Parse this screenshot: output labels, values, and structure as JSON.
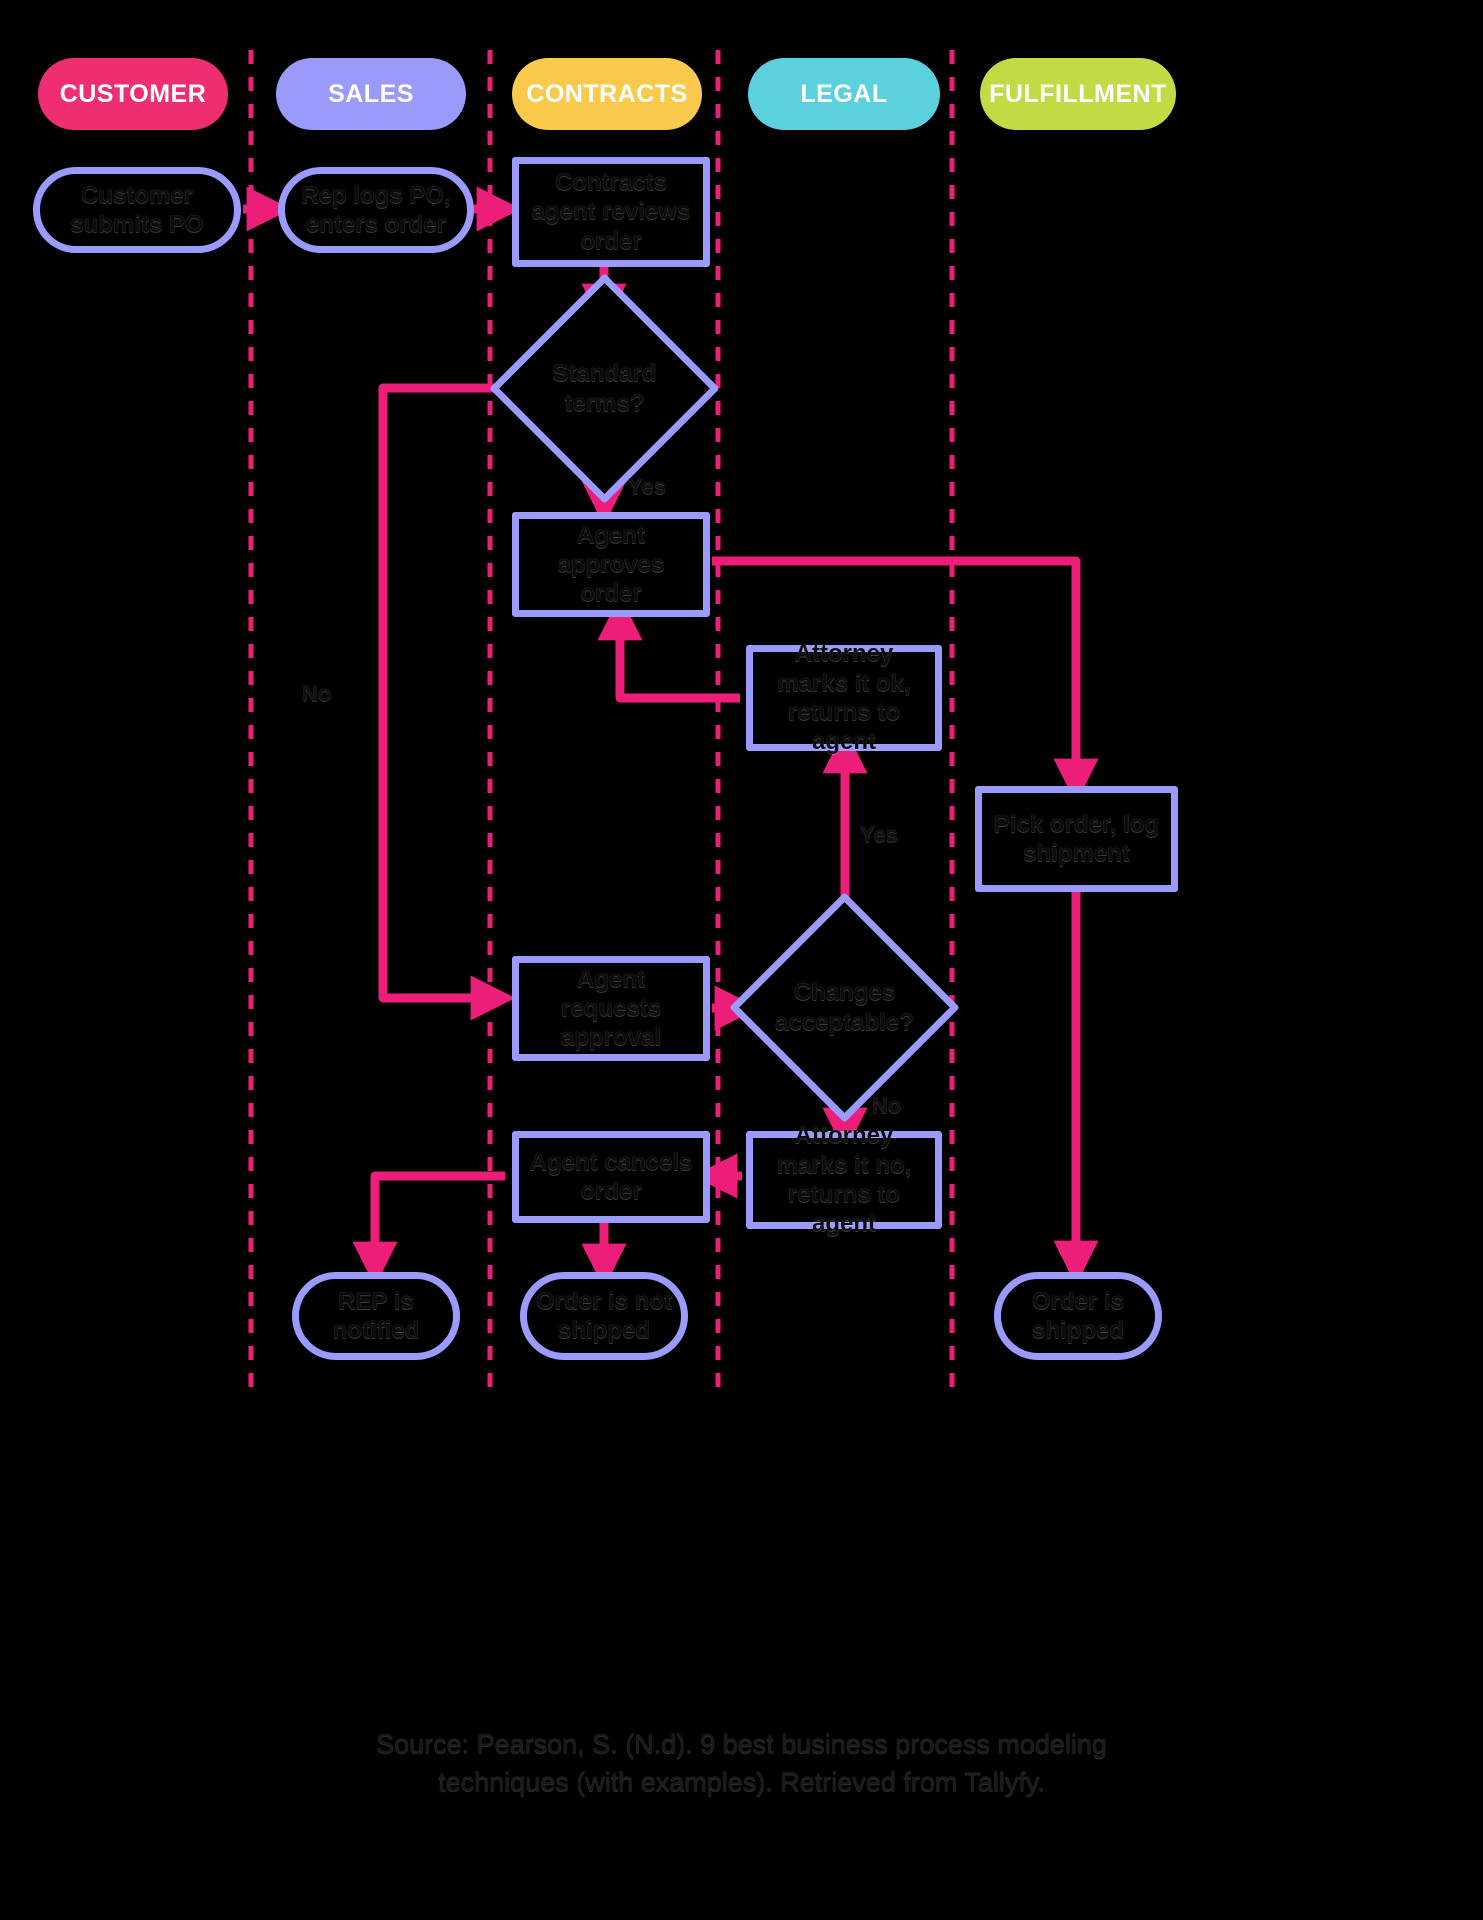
{
  "diagram": {
    "type": "swimlane-flowchart",
    "background": "#000000",
    "palette": {
      "arrow": "#ED1E79",
      "lane_divider": "#ED1E79",
      "node_border": "#9b9bff",
      "node_fill": "#000000",
      "node_text": "#0c0c0c"
    }
  },
  "lanes": [
    {
      "id": "customer",
      "label": "CUSTOMER",
      "color": "#EE2D72"
    },
    {
      "id": "sales",
      "label": "SALES",
      "color": "#9A9AFB"
    },
    {
      "id": "contracts",
      "label": "CONTRACTS",
      "color": "#FBC94C"
    },
    {
      "id": "legal",
      "label": "LEGAL",
      "color": "#5BD1DE"
    },
    {
      "id": "fulfillment",
      "label": "FULFILLMENT",
      "color": "#C2DB45"
    }
  ],
  "nodes": [
    {
      "id": "customer_submits_po",
      "lane": "customer",
      "shape": "terminal",
      "label": "Customer submits PO"
    },
    {
      "id": "rep_logs_po",
      "lane": "sales",
      "shape": "terminal",
      "label": "Rep logs PO, enters order"
    },
    {
      "id": "contracts_reviews",
      "lane": "contracts",
      "shape": "process",
      "label": "Contracts agent reviews order"
    },
    {
      "id": "standard_terms",
      "lane": "contracts",
      "shape": "decision",
      "label": "Standard terms?"
    },
    {
      "id": "agent_approves",
      "lane": "contracts",
      "shape": "process",
      "label": "Agent approves order"
    },
    {
      "id": "attorney_ok",
      "lane": "legal",
      "shape": "process",
      "label": "Attorney marks it ok, returns to agent"
    },
    {
      "id": "pick_order",
      "lane": "fulfillment",
      "shape": "process",
      "label": "Pick order, log shipment"
    },
    {
      "id": "agent_requests",
      "lane": "contracts",
      "shape": "process",
      "label": "Agent requests approval"
    },
    {
      "id": "changes_acceptable",
      "lane": "legal",
      "shape": "decision",
      "label": "Changes acceptable?"
    },
    {
      "id": "agent_cancels",
      "lane": "contracts",
      "shape": "process",
      "label": "Agent cancels order"
    },
    {
      "id": "attorney_no",
      "lane": "legal",
      "shape": "process",
      "label": "Attorney marks it no, returns to agent"
    },
    {
      "id": "rep_notified",
      "lane": "sales",
      "shape": "terminal",
      "label": "REP is notified"
    },
    {
      "id": "order_not_shipped",
      "lane": "contracts",
      "shape": "terminal",
      "label": "Order is not shipped"
    },
    {
      "id": "order_is_shipped",
      "lane": "fulfillment",
      "shape": "terminal",
      "label": "Order is shipped"
    }
  ],
  "edge_labels": {
    "standard_terms_no": "No",
    "standard_terms_yes": "Yes",
    "changes_yes": "Yes",
    "changes_no": "No"
  },
  "caption": {
    "line1": "Source: Pearson, S. (N.d). 9 best business process modeling",
    "line2": "techniques (with examples). Retrieved from Tallyfy."
  }
}
